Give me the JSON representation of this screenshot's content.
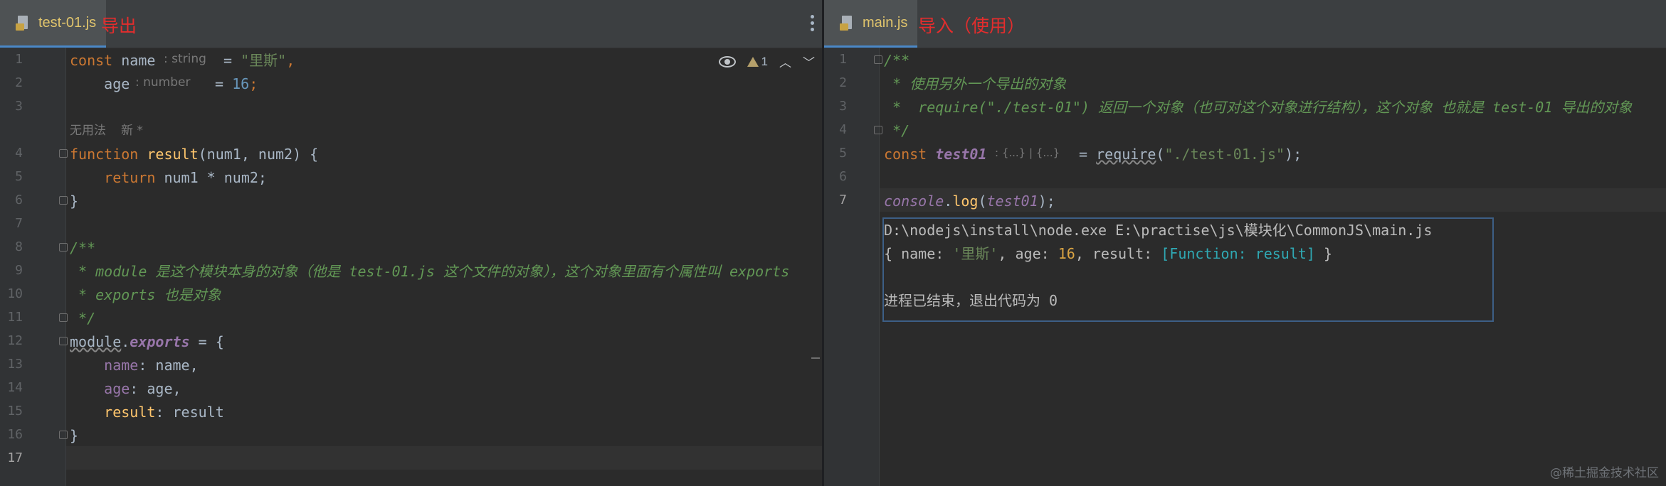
{
  "left_editor": {
    "tab_label": "test-01.js",
    "annotation": "导出",
    "line_numbers": [
      "1",
      "2",
      "3",
      "4",
      "5",
      "6",
      "7",
      "8",
      "9",
      "10",
      "11",
      "12",
      "13",
      "14",
      "15",
      "16",
      "17"
    ],
    "usage_hint": "无用法",
    "usage_new": "新 *",
    "type_hint_string": ": string",
    "type_hint_number": ": number",
    "warning_count": "1",
    "code": {
      "l1_kw": "const",
      "l1_name": " name",
      "l1_eq": " = ",
      "l1_str": "\"里斯\"",
      "l1_comma": ",",
      "l2_name": "    age",
      "l2_eq": " = ",
      "l2_num": "16",
      "l2_semi": ";",
      "l4_kw": "function",
      "l4_fn": " result",
      "l4_rest": "(num1, num2) {",
      "l5_kw": "    return",
      "l5_rest": " num1 * num2;",
      "l6": "}",
      "l8": "/**",
      "l9": " * module 是这个模块本身的对象（他是 test-01.js 这个文件的对象），这个对象里面有个属性叫 exports",
      "l10": " * exports 也是对象",
      "l11": " */",
      "l12_obj": "module",
      "l12_dot": ".",
      "l12_prop": "exports",
      "l12_rest": " = {",
      "l13_prop": "    name",
      "l13_rest": ": name,",
      "l14_prop": "    age",
      "l14_rest": ": age,",
      "l15_prop": "    result",
      "l15_rest": ": result",
      "l16": "}"
    }
  },
  "right_editor": {
    "tab_label": "main.js",
    "annotation": "导入（使用）",
    "line_numbers": [
      "1",
      "2",
      "3",
      "4",
      "5",
      "6",
      "7"
    ],
    "type_hint": ": {...} | {...}",
    "code": {
      "l1": "/**",
      "l2": " * 使用另外一个导出的对象",
      "l3": " *  require(\"./test-01\") 返回一个对象（也可对这个对象进行结构），这个对象 也就是 test-01 导出的对象",
      "l4": " */",
      "l5_kw": "const",
      "l5_var": " test01",
      "l5_eq": " = ",
      "l5_fn": "require",
      "l5_p1": "(",
      "l5_str": "\"./test-01.js\"",
      "l5_p2": ");",
      "l7_obj": "console",
      "l7_dot": ".",
      "l7_method": "log",
      "l7_p1": "(",
      "l7_var": "test01",
      "l7_p2": ");"
    }
  },
  "console": {
    "command": "D:\\nodejs\\install\\node.exe E:\\practise\\js\\模块化\\CommonJS\\main.js",
    "output_open": "{ name: ",
    "output_name": "'里斯'",
    "output_mid": ", age: ",
    "output_age": "16",
    "output_mid2": ", result: ",
    "output_fn": "[Function: result]",
    "output_close": " }",
    "exit_message": "进程已结束，退出代码为 0"
  },
  "watermark": "@稀土掘金技术社区"
}
